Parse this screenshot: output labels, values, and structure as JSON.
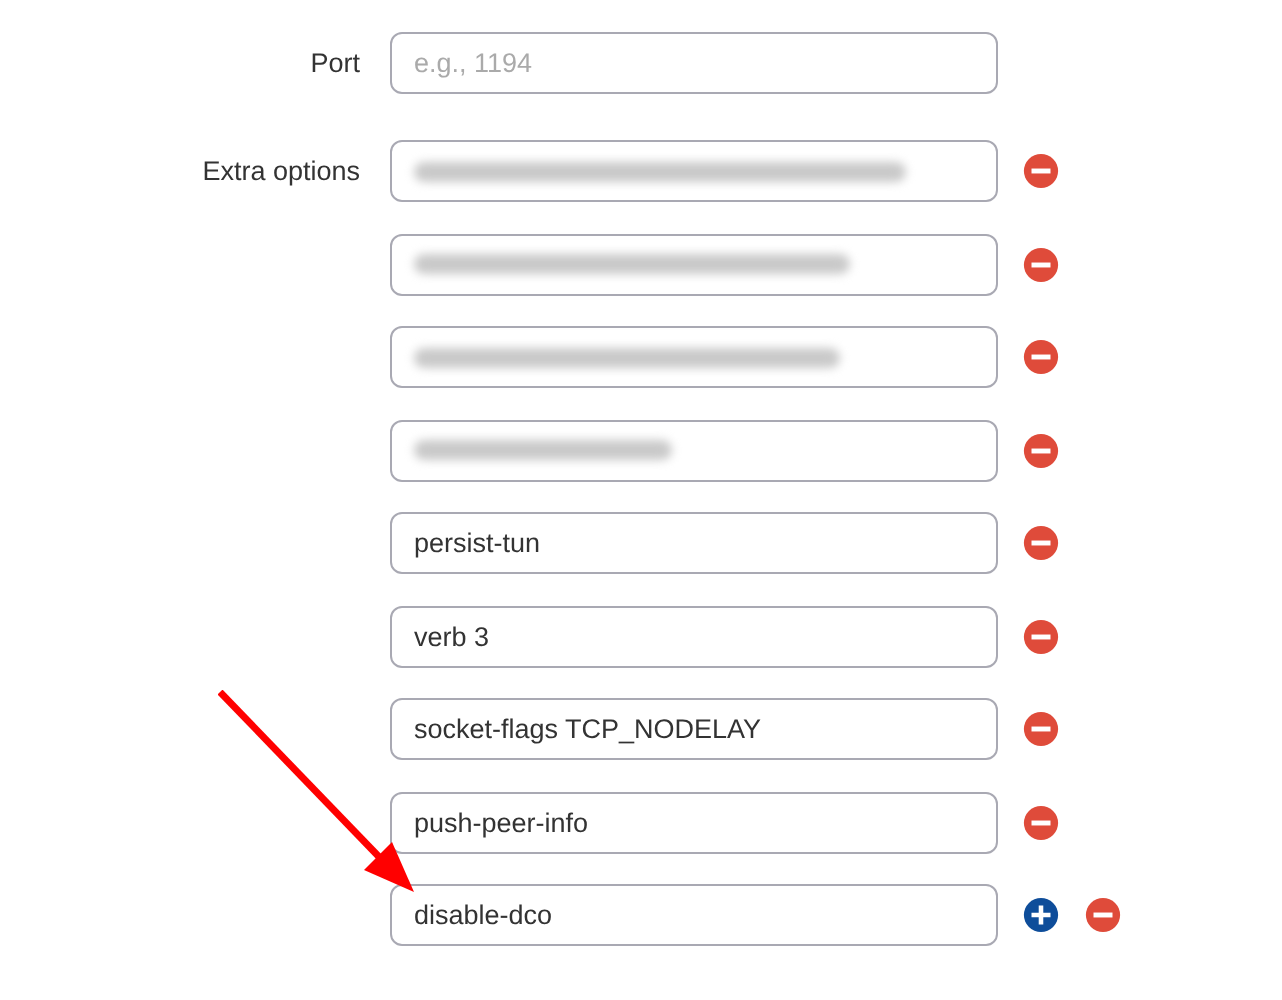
{
  "port": {
    "label": "Port",
    "placeholder": "e.g., 1194"
  },
  "extra_options": {
    "label": "Extra options",
    "items": [
      {
        "kind": "redacted",
        "add_button": false
      },
      {
        "kind": "redacted",
        "add_button": false
      },
      {
        "kind": "redacted",
        "add_button": false
      },
      {
        "kind": "redacted",
        "add_button": false
      },
      {
        "kind": "text",
        "value": "persist-tun",
        "add_button": false
      },
      {
        "kind": "text",
        "value": "verb 3",
        "add_button": false
      },
      {
        "kind": "text",
        "value": "socket-flags TCP_NODELAY",
        "add_button": false
      },
      {
        "kind": "text",
        "value": "push-peer-info",
        "add_button": false
      },
      {
        "kind": "text",
        "value": "disable-dco",
        "add_button": true
      }
    ]
  },
  "annotation": {
    "kind": "arrow",
    "color": "#ff0000"
  }
}
